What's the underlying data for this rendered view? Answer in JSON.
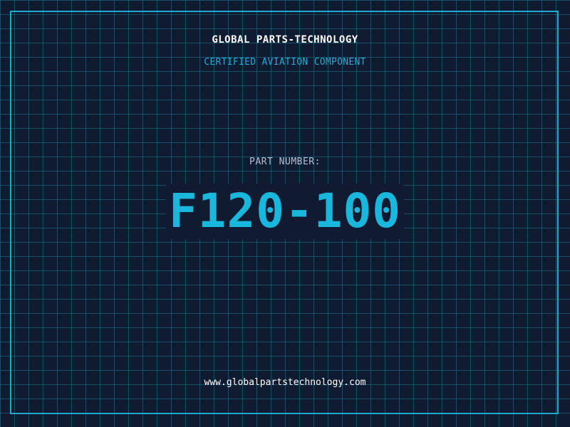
{
  "header": {
    "company_name": "GLOBAL PARTS-TECHNOLOGY",
    "tagline": "CERTIFIED AVIATION COMPONENT"
  },
  "part": {
    "label": "PART NUMBER:",
    "number": "F120-100"
  },
  "footer": {
    "website": "www.globalpartstechnology.com"
  },
  "colors": {
    "background": "#101a30",
    "grid": "#1c7896",
    "accent": "#1ab7dc",
    "frame": "#1fa8d0",
    "text": "#ffffff",
    "muted": "#b4bfd0"
  }
}
